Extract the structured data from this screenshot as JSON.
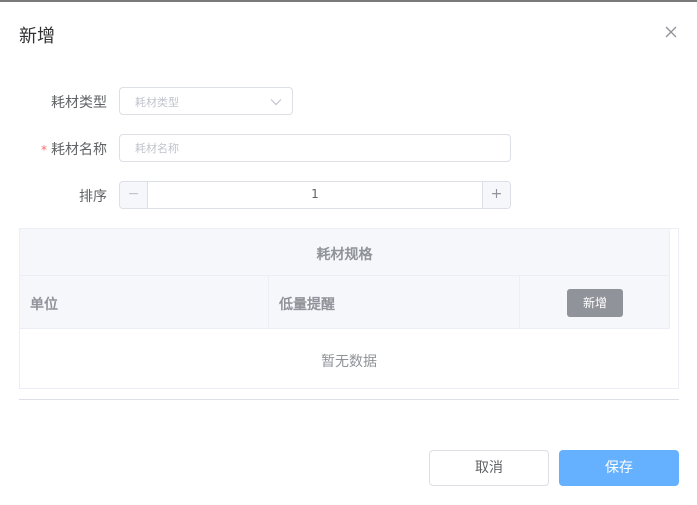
{
  "dialog": {
    "title": "新增"
  },
  "form": {
    "material_type": {
      "label": "耗材类型",
      "placeholder": "耗材类型"
    },
    "material_name": {
      "required_mark": "*",
      "label": "耗材名称",
      "placeholder": "耗材名称"
    },
    "sort": {
      "label": "排序",
      "value": "1",
      "minus": "−",
      "plus": "+"
    }
  },
  "spec_table": {
    "title": "耗材规格",
    "columns": [
      "单位",
      "低量提醒"
    ],
    "add_button": "新增",
    "empty_text": "暂无数据"
  },
  "footer": {
    "cancel_label": "取消",
    "save_label": "保存"
  },
  "colors": {
    "primary": "#66b1ff",
    "required": "#f56c6c",
    "neutral_button": "#909399"
  }
}
